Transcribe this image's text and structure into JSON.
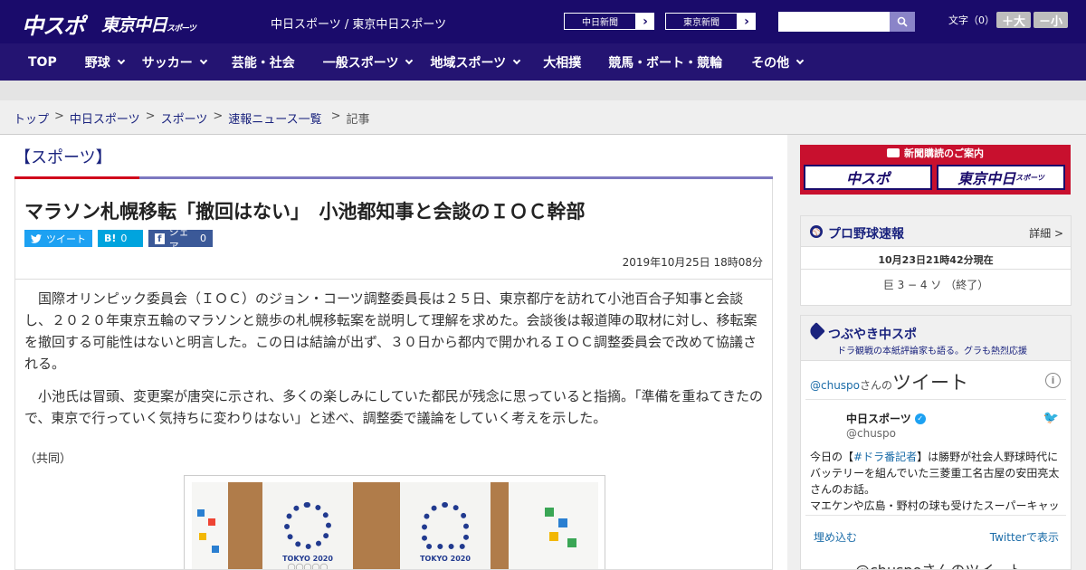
{
  "header": {
    "logo_primary": "中スポ",
    "logo_secondary": "東京中日",
    "logo_secondary_sub": "スポーツ",
    "tagline": "中日スポーツ / 東京中日スポーツ",
    "paper_buttons": [
      "中日新聞",
      "東京新聞"
    ],
    "search_placeholder": "",
    "font_size_label": "文字（0）",
    "font_plus": "＋大",
    "font_minus": "－小"
  },
  "nav": {
    "items": [
      {
        "label": "TOP",
        "dropdown": false
      },
      {
        "label": "野球",
        "dropdown": true
      },
      {
        "label": "サッカー",
        "dropdown": true
      },
      {
        "label": "芸能・社会",
        "dropdown": false
      },
      {
        "label": "一般スポーツ",
        "dropdown": true
      },
      {
        "label": "地域スポーツ",
        "dropdown": true
      },
      {
        "label": "大相撲",
        "dropdown": false
      },
      {
        "label": "競馬・ボート・競輪",
        "dropdown": false
      },
      {
        "label": "その他",
        "dropdown": true
      }
    ]
  },
  "breadcrumb": {
    "links": [
      "トップ",
      "中日スポーツ",
      "スポーツ",
      "速報ニュース一覧"
    ],
    "current": "記事",
    "separator": ">"
  },
  "section": {
    "title": "【スポーツ】"
  },
  "article": {
    "title": "マラソン札幌移転「撤回はない」　小池都知事と会談のＩＯＣ幹部",
    "share": {
      "tweet_label": "ツイート",
      "hatena_label": "B!",
      "hatena_count": "0",
      "facebook_label": "シェア",
      "facebook_count": "0"
    },
    "date": "2019年10月25日 18時08分",
    "paragraphs": [
      "国際オリンピック委員会（ＩＯＣ）のジョン・コーツ調整委員長は２５日、東京都庁を訪れて小池百合子知事と会談し、２０２０年東京五輪のマラソンと競歩の札幌移転案を説明して理解を求めた。会談後は報道陣の取材に対し、移転案を撤回する可能性はないと明言した。この日は結論が出ず、３０日から都内で開かれるＩＯＣ調整委員会で改めて協議される。",
      "小池氏は冒頭、変更案が唐突に示され、多くの楽しみにしていた都民が残念に思っていると指摘。「準備を重ねてきたので、東京で行っていく気持ちに変わりはない」と述べ、調整委で議論をしていく考えを示した。"
    ],
    "credit": "（共同）",
    "photo_panels": [
      "TOKYO 2020",
      "TOKYO 2020"
    ]
  },
  "sidebar": {
    "promo": {
      "heading": "新聞購読のご案内",
      "option_a": "中スポ",
      "option_b": "東京中日",
      "option_b_sub": "スポーツ"
    },
    "baseball": {
      "title": "プロ野球速報",
      "detail": "詳細 >",
      "as_of": "10月23日21時42分現在",
      "score": "巨 3 − 4 ソ （終了）"
    },
    "twitter": {
      "title": "つぶやき中スポ",
      "subtitle": "ドラ観戦の本紙評論家も語る。グラも熱烈応援",
      "timeline_handle": "@chuspo",
      "timeline_suffix": "さんの",
      "timeline_label": "ツイート",
      "account_name": "中日スポーツ",
      "account_handle": "@chuspo",
      "tweet_prefix": "今日の【",
      "tweet_hashtag": "#ドラ番記者",
      "tweet_body": "】は勝野が社会人野球時代にバッテリーを組んでいた三菱重工名古屋の安田亮太さんのお話。",
      "tweet_line2": "マエケンや広島・野村の球も受けたスーパーキャッ",
      "embed_label": "埋め込む",
      "view_on_twitter": "Twitterで表示",
      "more_label": "@chuspoさんのツイート"
    }
  },
  "colors": {
    "header_bg": "#1a0b6b",
    "nav_bg": "#241472",
    "accent_red": "#d0021b",
    "link_blue": "#1a237e"
  }
}
